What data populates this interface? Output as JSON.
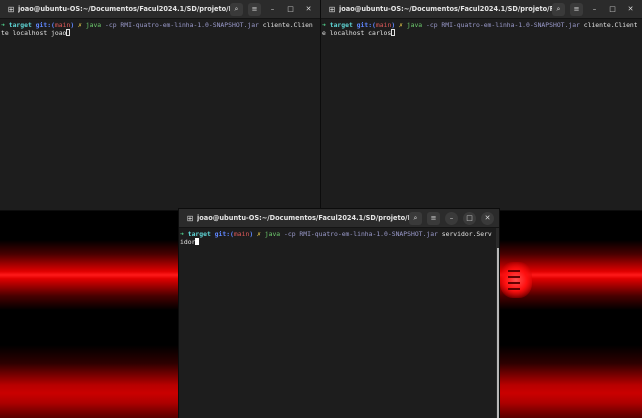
{
  "windows": {
    "left": {
      "title": "joao@ubuntu-OS:~/Documentos/Facul2024.1/SD/projeto/RM...",
      "prompt_arrow": "➜",
      "dir": "target",
      "git_label": "git:(",
      "branch": "main",
      "git_close": ")",
      "dirty": "✗",
      "cmd": "java",
      "args": "-cp RMI-quatro-em-linha-1.0-SNAPSHOT.jar",
      "rest": "cliente.Cliente localhost joao"
    },
    "right": {
      "title": "joao@ubuntu-OS:~/Documentos/Facul2024.1/SD/projeto/RM...",
      "prompt_arrow": "➜",
      "dir": "target",
      "git_label": "git:(",
      "branch": "main",
      "git_close": ")",
      "dirty": "✗",
      "cmd": "java",
      "args": "-cp RMI-quatro-em-linha-1.0-SNAPSHOT.jar",
      "rest": "cliente.Cliente localhost carlos"
    },
    "center": {
      "title": "joao@ubuntu-OS:~/Documentos/Facul2024.1/SD/projeto/RM...",
      "prompt_arrow": "➜",
      "dir": "target",
      "git_label": "git:(",
      "branch": "main",
      "git_close": ")",
      "dirty": "✗",
      "cmd": "java",
      "args": "-cp RMI-quatro-em-linha-1.0-SNAPSHOT.jar",
      "rest": "servidor.Servidor"
    }
  },
  "icons": {
    "new_tab": "new-tab-icon",
    "search": "search-icon",
    "menu": "hamburger-menu-icon",
    "minimize": "minimize-icon",
    "maximize": "maximize-icon",
    "close": "close-icon"
  },
  "colors": {
    "terminal_bg": "#1d1d1d",
    "titlebar_bg": "#2b2b2b",
    "wallpaper_accent": "#e00000"
  }
}
